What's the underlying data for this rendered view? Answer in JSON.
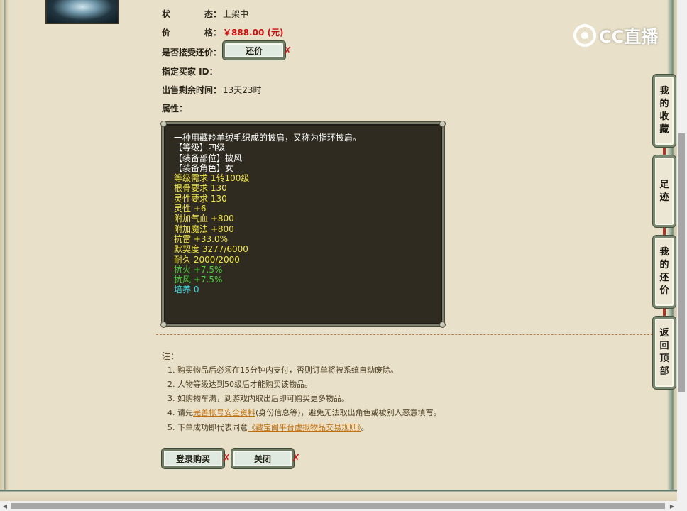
{
  "item": {
    "status_label": "状　　态：",
    "status_label_a": "状",
    "status_label_b": "态：",
    "status_value": "上架中",
    "price_label_a": "价",
    "price_label_b": "格：",
    "price_value": "￥888.00 (元)",
    "accept_offer_label": "是否接受还价：",
    "offer_button": "还价",
    "buyer_id_label": "指定买家 ID：",
    "time_left_label": "出售剩余时间：",
    "time_left_value": "13天23时",
    "attributes_label": "属性："
  },
  "attributes": {
    "lines": [
      {
        "text": "一种用藏羚羊绒毛织成的披肩，又称为指环披肩。",
        "color": "#ffffff"
      },
      {
        "text": "【等级】四级",
        "color": "#ffffff"
      },
      {
        "text": "【装备部位】披风",
        "color": "#ffffff"
      },
      {
        "text": "【装备角色】女",
        "color": "#ffffff"
      },
      {
        "text": "等级需求 1转100级",
        "color": "#f2e64c"
      },
      {
        "text": "根骨要求 130",
        "color": "#f2e64c"
      },
      {
        "text": "灵性要求 130",
        "color": "#f2e64c"
      },
      {
        "text": "灵性 +6",
        "color": "#f2e64c"
      },
      {
        "text": "附加气血 +800",
        "color": "#f2e64c"
      },
      {
        "text": "附加魔法 +800",
        "color": "#f2e64c"
      },
      {
        "text": "抗雷 +33.0%",
        "color": "#f2e64c"
      },
      {
        "text": "默契度 3277/6000",
        "color": "#f2e64c"
      },
      {
        "text": "耐久 2000/2000",
        "color": "#f2e64c"
      },
      {
        "text": "抗火 +7.5%",
        "color": "#4ccf3c"
      },
      {
        "text": "抗风 +7.5%",
        "color": "#4ccf3c"
      },
      {
        "text": "培养 0",
        "color": "#3fd6e6"
      }
    ]
  },
  "notes": {
    "title": "注：",
    "n1": "1. 购买物品后必须在15分钟内支付，否则订单将被系统自动废除。",
    "n2": "2. 人物等级达到50级后才能购买该物品。",
    "n3": "3. 如购物车满，到游戏内取出后即可购买更多物品。",
    "n4_pre": "4. 请先",
    "n4_link": "完善帐号安全资料",
    "n4_post": "(身份信息等)，避免无法取出角色或被别人恶意填写。",
    "n5_pre": "5. 下单成功即代表同意",
    "n5_link": "《藏宝阁平台虚拟物品交易规则》",
    "n5_post": "。"
  },
  "actions": {
    "login_buy": "登录购买",
    "close": "关闭"
  },
  "side_tabs": {
    "favorites": "我的收藏",
    "footprints": "足迹",
    "my_offers": "我的还价",
    "back_top": "返回顶部"
  },
  "watermark": {
    "text": "CC直播"
  },
  "colors": {
    "price": "#cc1010",
    "link": "#c07010",
    "close_mark": "#c0191e"
  }
}
